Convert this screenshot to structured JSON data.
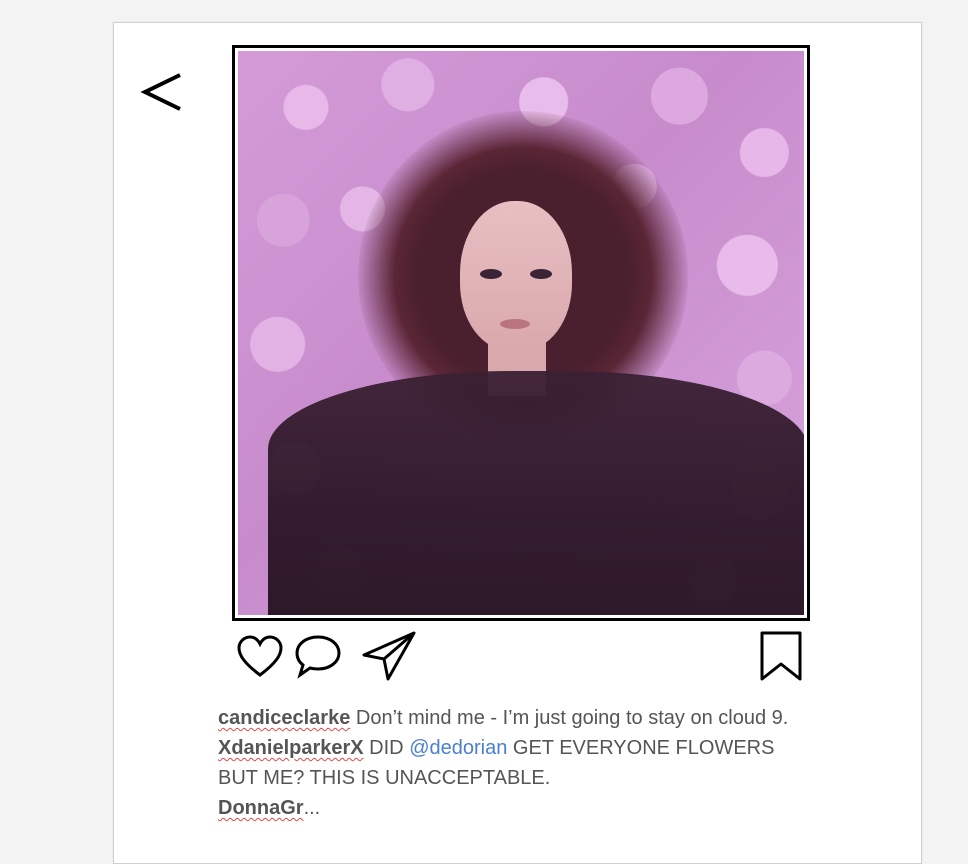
{
  "header": {
    "back_label": "<"
  },
  "post": {
    "image_description_icon": "photo"
  },
  "actions": {
    "like_icon": "heart-icon",
    "comment_icon": "comment-icon",
    "share_icon": "send-icon",
    "save_icon": "bookmark-icon"
  },
  "comments": [
    {
      "user": "candiceclarke",
      "text": " Don’t mind me - I’m just going to stay on cloud 9."
    },
    {
      "user": "XdanielparkerX",
      "text_before": " DID ",
      "mention": "@dedorian",
      "text_after": " GET EVERYONE FLOWERS BUT ME? THIS IS UNACCEPTABLE."
    },
    {
      "user": "DonnaGr",
      "text": "..."
    }
  ],
  "colors": {
    "mention": "#4a7fd0",
    "username_underline": "#e04a4a",
    "text": "#555555"
  }
}
